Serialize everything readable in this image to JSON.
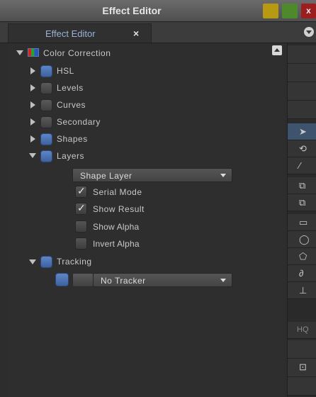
{
  "window": {
    "title": "Effect Editor"
  },
  "tab": {
    "label": "Effect Editor",
    "close_glyph": "×"
  },
  "window_buttons": {
    "close_glyph": "x"
  },
  "tree": {
    "root": {
      "label": "Color Correction"
    },
    "items": [
      {
        "label": "HSL"
      },
      {
        "label": "Levels"
      },
      {
        "label": "Curves"
      },
      {
        "label": "Secondary"
      },
      {
        "label": "Shapes"
      },
      {
        "label": "Layers"
      }
    ],
    "layers": {
      "dropdown_value": "Shape Layer",
      "options": [
        {
          "label": "Serial Mode",
          "checked": true
        },
        {
          "label": "Show Result",
          "checked": true
        },
        {
          "label": "Show Alpha",
          "checked": false
        },
        {
          "label": "Invert Alpha",
          "checked": false
        }
      ]
    },
    "tracking": {
      "label": "Tracking",
      "dropdown_value": "No Tracker"
    }
  },
  "toolbar": {
    "hq_label": "HQ",
    "tools": [
      {
        "name": "select-arrow-icon",
        "glyph": "➤"
      },
      {
        "name": "rotate-icon",
        "glyph": "⟲"
      },
      {
        "name": "brush-icon",
        "glyph": "⁄"
      },
      {
        "name": "copy-icon",
        "glyph": "⧉"
      },
      {
        "name": "paste-icon",
        "glyph": "⧉"
      },
      {
        "name": "rectangle-icon",
        "glyph": "▭"
      },
      {
        "name": "ellipse-icon",
        "glyph": "◯"
      },
      {
        "name": "polygon-icon",
        "glyph": "⬠"
      },
      {
        "name": "freehand-icon",
        "glyph": "∂"
      },
      {
        "name": "stamp-icon",
        "glyph": "⊥"
      }
    ]
  },
  "colors": {
    "accent_blue": "#4a6fae",
    "tab_text": "#9ab3d6",
    "background": "#2e2e2e"
  }
}
